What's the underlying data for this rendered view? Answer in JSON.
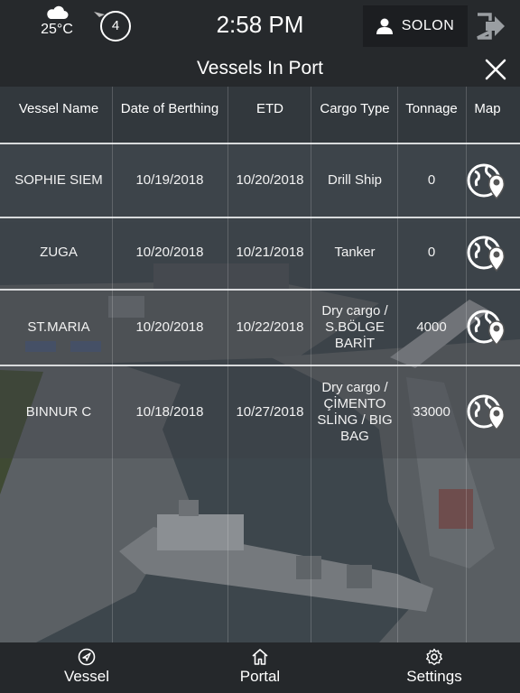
{
  "header": {
    "temperature": "25°C",
    "weather_icon": "cloud-icon",
    "notification_count": "4",
    "time": "2:58 PM",
    "user_name": "SOLON",
    "logout_icon": "logout-icon"
  },
  "page": {
    "title": "Vessels In Port"
  },
  "table": {
    "columns": [
      "Vessel Name",
      "Date of Berthing",
      "ETD",
      "Cargo Type",
      "Tonnage",
      "Map"
    ],
    "rows": [
      {
        "vessel": "SOPHIE SIEM",
        "berthing": "10/19/2018",
        "etd": "10/20/2018",
        "cargo": [
          "Drill Ship"
        ],
        "tonnage": "0"
      },
      {
        "vessel": "ZUGA",
        "berthing": "10/20/2018",
        "etd": "10/21/2018",
        "cargo": [
          "Tanker"
        ],
        "tonnage": "0"
      },
      {
        "vessel": "ST.MARIA",
        "berthing": "10/20/2018",
        "etd": "10/22/2018",
        "cargo": [
          "Dry cargo /",
          "S.BÖLGE",
          "BARİT"
        ],
        "tonnage": "4000"
      },
      {
        "vessel": "BINNUR C",
        "berthing": "10/18/2018",
        "etd": "10/27/2018",
        "cargo": [
          "Dry cargo /",
          "ÇİMENTO",
          "SLİNG / BIG",
          "BAG"
        ],
        "tonnage": "33000"
      }
    ]
  },
  "nav": {
    "vessel": "Vessel",
    "portal": "Portal",
    "settings": "Settings"
  },
  "colors": {
    "header_bg": "#26292c",
    "nav_bg": "#25282b",
    "water": "#3d464c",
    "land": "#5a5f63",
    "grass": "#3f4a33"
  }
}
